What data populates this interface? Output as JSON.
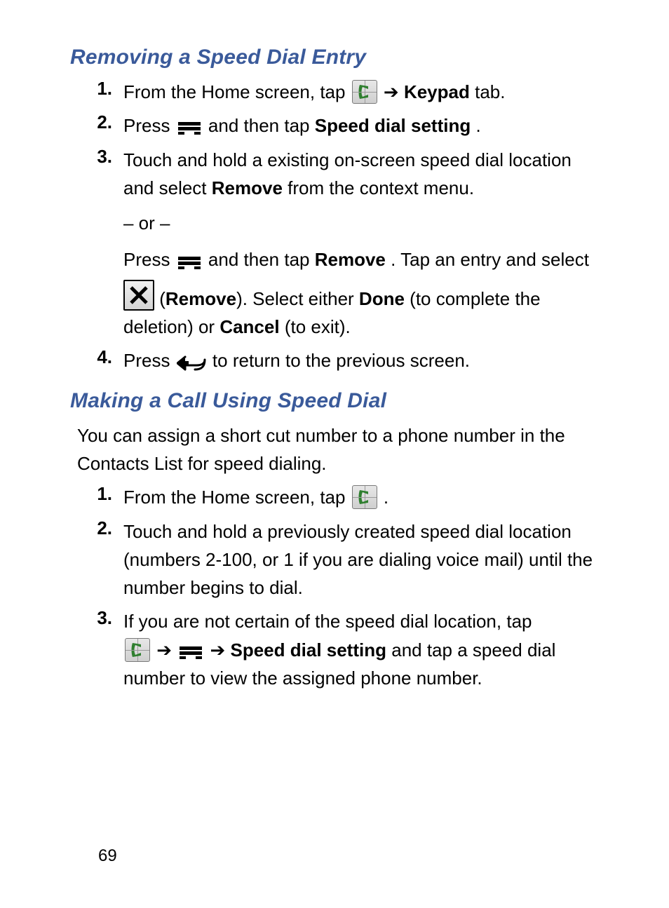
{
  "page_number": "69",
  "section1": {
    "heading": "Removing a Speed Dial Entry",
    "s1_pre": "From the Home screen, tap ",
    "s1_arrow": " ➔ ",
    "s1_bold": "Keypad",
    "s1_post": " tab.",
    "s2_pre": "Press ",
    "s2_mid": " and then tap ",
    "s2_bold": "Speed dial setting",
    "s2_post": ".",
    "s3a_pre": "Touch and hold a existing on-screen speed dial location and select ",
    "s3a_bold": "Remove",
    "s3a_post": " from the context menu.",
    "or": "– or –",
    "s3b_pre": "Press ",
    "s3b_mid": " and then tap ",
    "s3b_b1": "Remove",
    "s3b_sent1_end": ". Tap an entry and select ",
    "s3b_paren_open": " (",
    "s3b_b2": "Remove",
    "s3b_paren_close": "). Select either ",
    "s3b_b3": "Done",
    "s3b_txt2": " (to complete the deletion) or ",
    "s3b_b4": "Cancel",
    "s3b_txt3": " (to exit).",
    "s4_pre": "Press ",
    "s4_post": " to return to the previous screen."
  },
  "section2": {
    "heading": "Making a Call Using Speed Dial",
    "intro": "You can assign a short cut number to a phone number in the Contacts List for speed dialing.",
    "s1_pre": "From the Home screen, tap ",
    "s1_post": ".",
    "s2": "Touch and hold a previously created speed dial location (numbers 2-100, or 1 if you are dialing voice mail) until the number begins to dial.",
    "s3_pre": "If you are not certain of the speed dial location, tap ",
    "s3_arrow1": " ➔ ",
    "s3_arrow2": " ➔ ",
    "s3_bold": "Speed dial setting",
    "s3_post": " and tap a speed dial number to view the assigned phone number."
  },
  "nums": {
    "n1": "1.",
    "n2": "2.",
    "n3": "3.",
    "n4": "4."
  }
}
